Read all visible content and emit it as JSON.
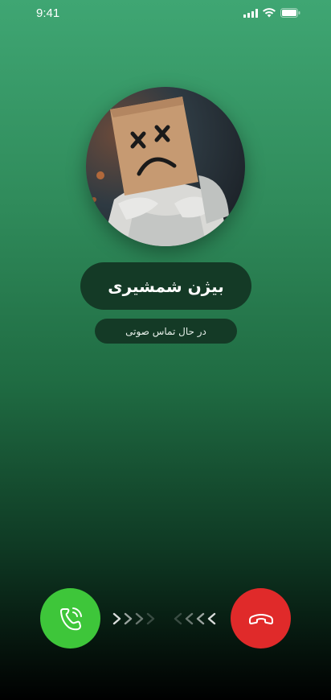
{
  "status_bar": {
    "time": "9:41"
  },
  "contact": {
    "name": "بیژن شمشیری",
    "call_status": "در حال تماس صوتی"
  },
  "icons": {
    "signal": "cellular-signal-icon",
    "wifi": "wifi-icon",
    "battery": "battery-icon",
    "accept": "phone-ringing-icon",
    "decline": "phone-hangup-icon"
  },
  "colors": {
    "accept": "#3ec63a",
    "decline": "#e02a2a",
    "pill_bg": "#143a26"
  }
}
